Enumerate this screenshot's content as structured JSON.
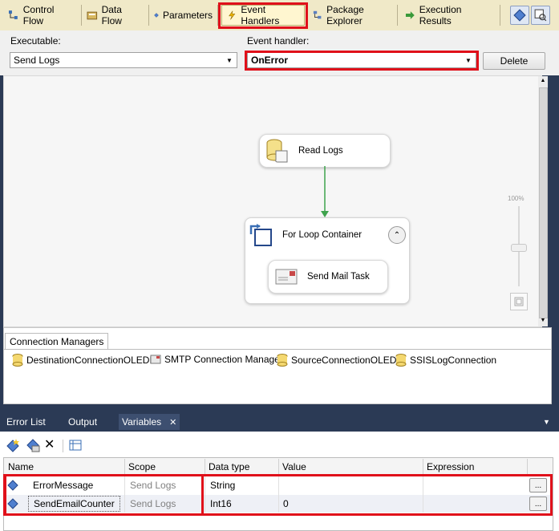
{
  "tabs": [
    {
      "label": "Control Flow",
      "icon": "control-flow-icon"
    },
    {
      "label": "Data Flow",
      "icon": "data-flow-icon"
    },
    {
      "label": "Parameters",
      "icon": "parameters-icon"
    },
    {
      "label": "Event Handlers",
      "icon": "lightning-icon"
    },
    {
      "label": "Package Explorer",
      "icon": "package-explorer-icon"
    },
    {
      "label": "Execution Results",
      "icon": "arrow-right-icon"
    }
  ],
  "header": {
    "executable_label": "Executable:",
    "executable_value": "Send Logs",
    "event_handler_label": "Event handler:",
    "event_handler_value": "OnError",
    "delete_label": "Delete"
  },
  "canvas": {
    "read_logs": "Read Logs",
    "container_title": "For Loop Container",
    "send_mail": "Send Mail Task",
    "zoom_label": "100%"
  },
  "connection_managers": {
    "tab_label": "Connection Managers",
    "items": [
      "DestinationConnectionOLEDB",
      "SMTP Connection Manager",
      "SourceConnectionOLEDB",
      "SSISLogConnection"
    ]
  },
  "bottom_tabs": {
    "error_list": "Error List",
    "output": "Output",
    "variables": "Variables",
    "close": "✕",
    "menu": "▼"
  },
  "variables": {
    "columns": [
      "Name",
      "Scope",
      "Data type",
      "Value",
      "Expression"
    ],
    "rows": [
      {
        "name": "ErrorMessage",
        "scope": "Send Logs",
        "type": "String",
        "value": "",
        "expr_button": "..."
      },
      {
        "name": "SendEmailCounter",
        "scope": "Send Logs",
        "type": "Int16",
        "value": "0",
        "expr_button": "..."
      }
    ]
  }
}
